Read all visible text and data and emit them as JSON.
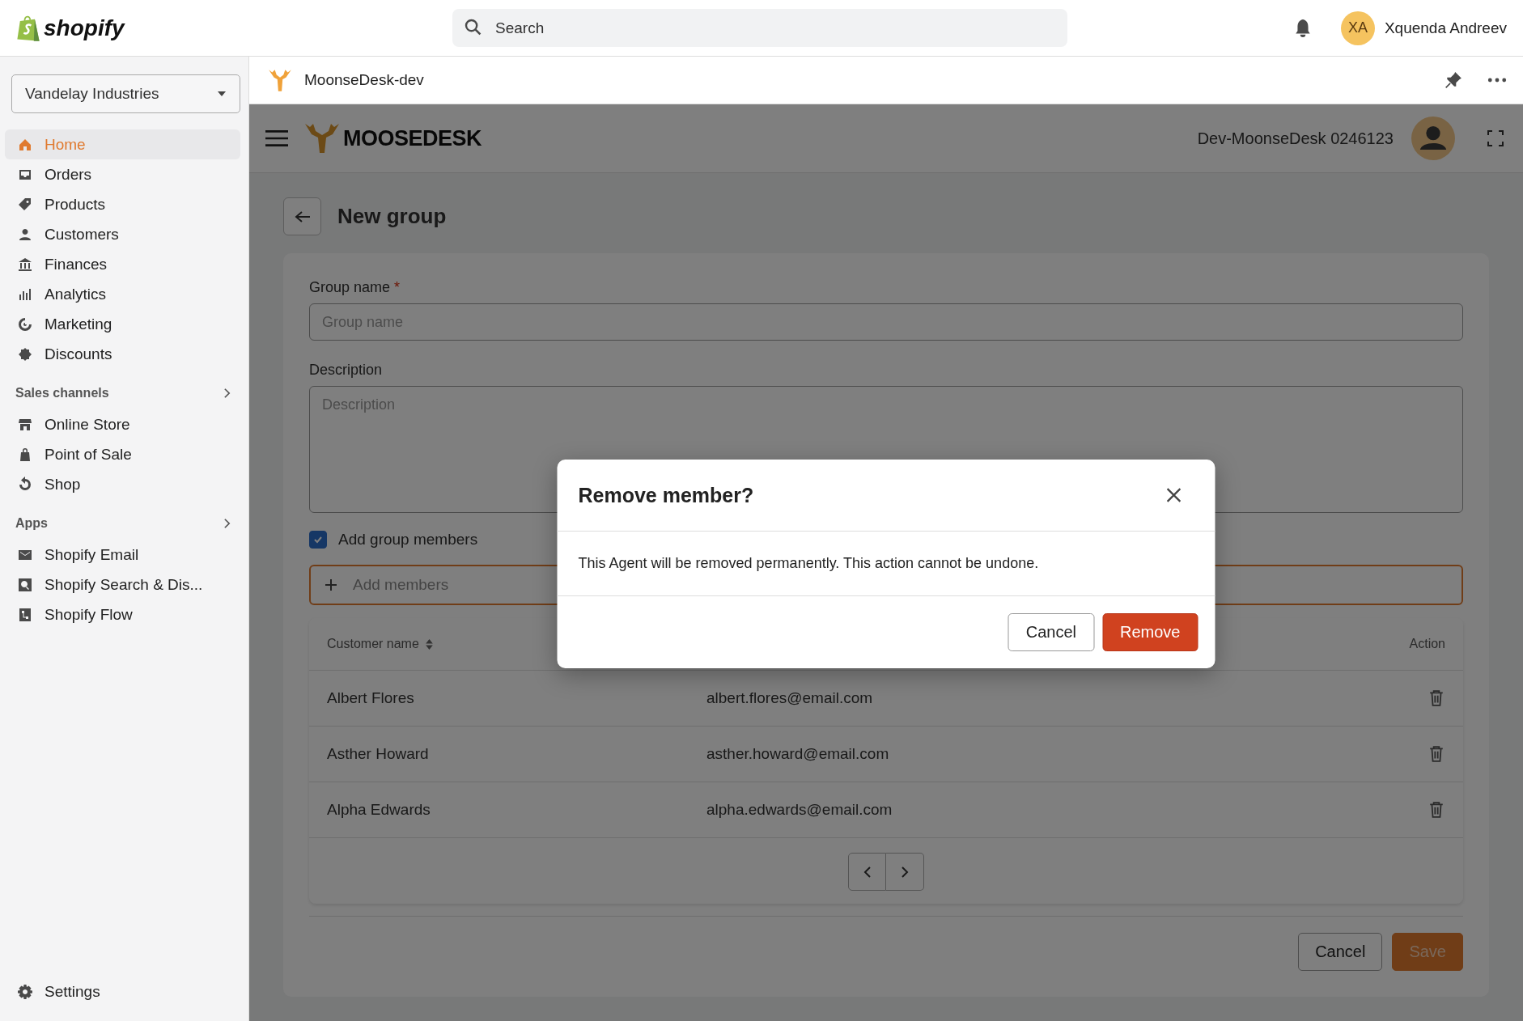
{
  "topbar": {
    "logo_text": "shopify",
    "search": {
      "placeholder": "Search"
    },
    "user": {
      "initials": "XA",
      "name": "Xquenda Andreev"
    }
  },
  "sidebar": {
    "store": "Vandelay Industries",
    "items": [
      {
        "label": "Home",
        "selected": true
      },
      {
        "label": "Orders",
        "selected": false
      },
      {
        "label": "Products",
        "selected": false
      },
      {
        "label": "Customers",
        "selected": false
      },
      {
        "label": "Finances",
        "selected": false
      },
      {
        "label": "Analytics",
        "selected": false
      },
      {
        "label": "Marketing",
        "selected": false
      },
      {
        "label": "Discounts",
        "selected": false
      }
    ],
    "sections": [
      {
        "title": "Sales channels",
        "items": [
          {
            "label": "Online Store",
            "selected": false
          },
          {
            "label": "Point of Sale",
            "selected": false
          },
          {
            "label": "Shop",
            "selected": false
          }
        ]
      },
      {
        "title": "Apps",
        "items": [
          {
            "label": "Shopify Email",
            "selected": false
          },
          {
            "label": "Shopify Search & Dis...",
            "selected": false
          },
          {
            "label": "Shopify Flow",
            "selected": false
          }
        ]
      }
    ],
    "settings": "Settings"
  },
  "app_bar": {
    "title": "MoonseDesk-dev"
  },
  "app": {
    "logo_text": "MOOSEDESK",
    "account": "Dev-MoonseDesk 0246123",
    "page_title": "New group",
    "form": {
      "group_name": {
        "label": "Group name",
        "required_mark": "*",
        "placeholder": "Group name"
      },
      "description": {
        "label": "Description",
        "placeholder": "Description"
      },
      "add_members_checkbox": {
        "label": "Add group members",
        "checked": true
      },
      "add_members": {
        "placeholder": "Add members",
        "focused": true
      },
      "table": {
        "columns": [
          "Customer name",
          "Action"
        ],
        "rows": [
          {
            "name": "Albert Flores",
            "email": "albert.flores@email.com"
          },
          {
            "name": "Asther Howard",
            "email": "asther.howard@email.com"
          },
          {
            "name": "Alpha Edwards",
            "email": "alpha.edwards@email.com"
          }
        ]
      },
      "buttons": [
        "Cancel",
        "Save"
      ]
    }
  },
  "modal": {
    "title": "Remove member?",
    "body": "This Agent will be removed permanently. This action cannot be undone.",
    "buttons": [
      "Cancel",
      "Remove"
    ]
  }
}
